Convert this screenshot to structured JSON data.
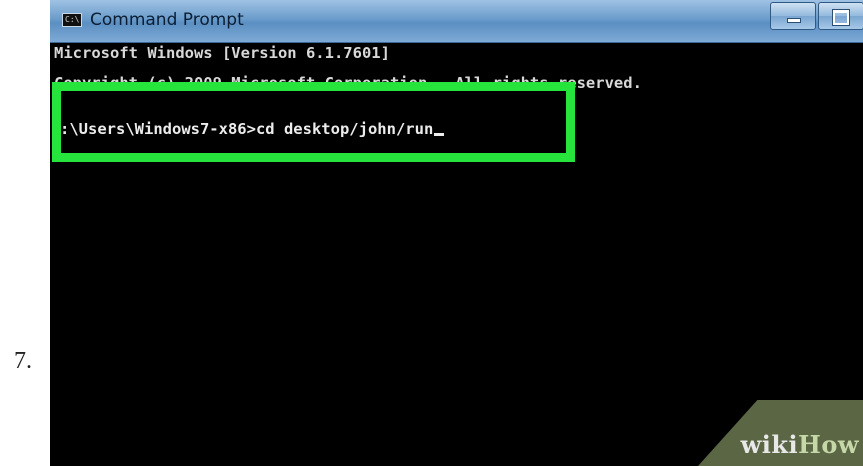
{
  "step": {
    "number": "7."
  },
  "window": {
    "title": "Command Prompt",
    "app_icon": "command-prompt-icon",
    "app_icon_glyph": "C:\\",
    "controls": [
      "minimize-icon",
      "maximize-icon"
    ]
  },
  "console": {
    "line_1": "Microsoft Windows [Version 6.1.7601]",
    "line_2": "Copyright (c) 2009 Microsoft Corporation.  All rights reserved.",
    "command_line": ":\\Users\\Windows7-x86>cd desktop/john/run"
  },
  "colors": {
    "highlight": "#27e43c",
    "console_bg": "#000000",
    "console_text": "#d8d8d8"
  },
  "watermark": {
    "part_a": "wiki",
    "part_b": "How"
  }
}
